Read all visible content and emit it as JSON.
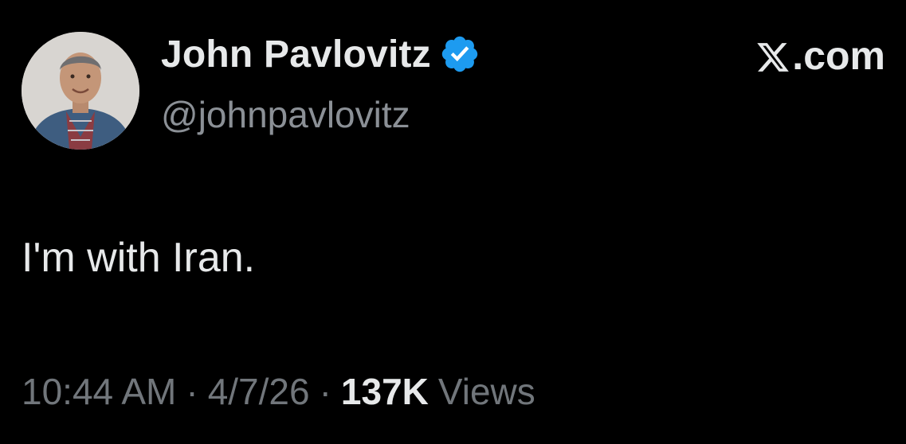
{
  "author": {
    "display_name": "John Pavlovitz",
    "handle": "@johnpavlovitz",
    "verified": true,
    "avatar_icon": "profile-photo"
  },
  "brand": {
    "label": ".com",
    "logo_icon": "x-logo-icon"
  },
  "tweet": {
    "text": "I'm with Iran."
  },
  "meta": {
    "time": "10:44 AM",
    "date": "4/7/26",
    "separator": "·",
    "views_count": "137K",
    "views_label": "Views"
  },
  "colors": {
    "background": "#000000",
    "primary_text": "#e7e9ea",
    "secondary_text": "#71767b",
    "verified_badge": "#1d9bf0"
  }
}
